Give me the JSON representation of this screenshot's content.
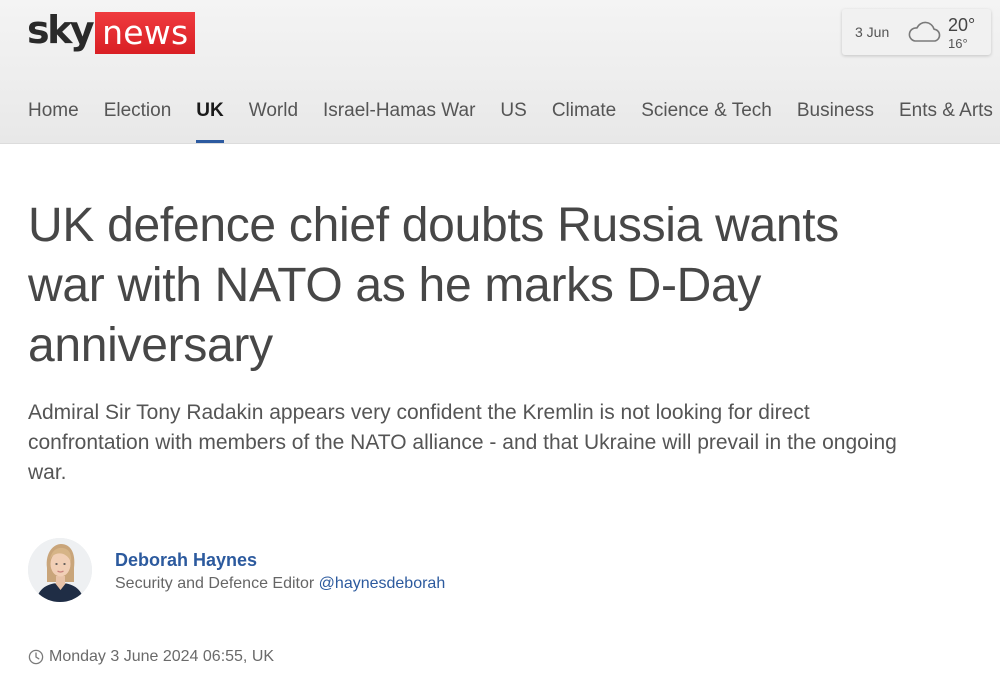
{
  "brand": {
    "logo_sky": "sky",
    "logo_news": "news",
    "accent_red": "#e0262a",
    "link_blue": "#2c5a9e",
    "nav_underline": "#2c5aa0"
  },
  "weather": {
    "date": "3 Jun",
    "high": "20°",
    "low": "16°",
    "icon": "cloud-icon"
  },
  "nav": {
    "items": [
      {
        "label": "Home"
      },
      {
        "label": "Election"
      },
      {
        "label": "UK",
        "active": true
      },
      {
        "label": "World"
      },
      {
        "label": "Israel-Hamas War"
      },
      {
        "label": "US"
      },
      {
        "label": "Climate"
      },
      {
        "label": "Science & Tech"
      },
      {
        "label": "Business"
      },
      {
        "label": "Ents & Arts"
      }
    ]
  },
  "article": {
    "headline": "UK defence chief doubts Russia wants war with NATO as he marks D-Day anniversary",
    "standfirst": "Admiral Sir Tony Radakin appears very confident the Kremlin is not looking for direct confrontation with members of the NATO alliance - and that Ukraine will prevail in the ongoing war.",
    "author": {
      "name": "Deborah Haynes",
      "role": "Security and Defence Editor",
      "handle": "@haynesdeborah"
    },
    "timestamp": "Monday 3 June 2024 06:55, UK"
  }
}
